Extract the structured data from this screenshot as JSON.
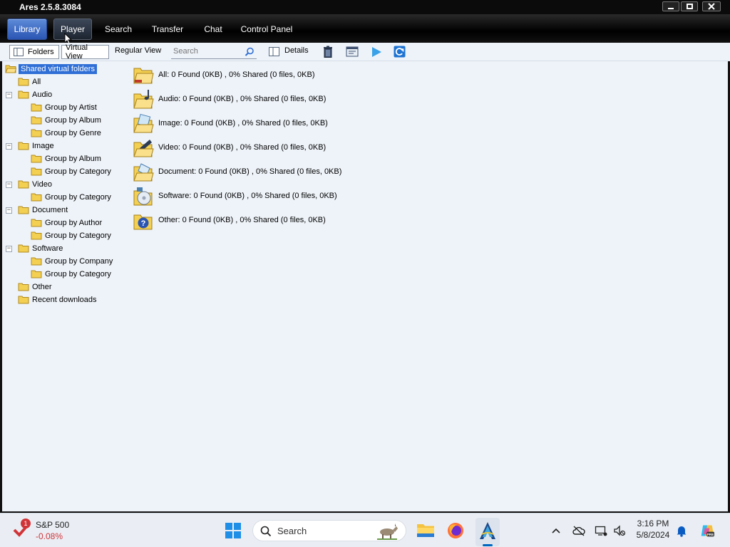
{
  "window": {
    "title": "Ares 2.5.8.3084"
  },
  "tabs": [
    {
      "label": "Library"
    },
    {
      "label": "Player"
    },
    {
      "label": "Search"
    },
    {
      "label": "Transfer"
    },
    {
      "label": "Chat"
    },
    {
      "label": "Control Panel"
    }
  ],
  "toolbar": {
    "folders_label": "Folders",
    "virtual_view_label": "Virtual View",
    "regular_view_label": "Regular View",
    "search_placeholder": "Search",
    "details_label": "Details"
  },
  "tree": {
    "root": "Shared virtual folders",
    "items": [
      {
        "label": "All"
      },
      {
        "label": "Audio"
      },
      {
        "label": "Group by Artist"
      },
      {
        "label": "Group by Album"
      },
      {
        "label": "Group by Genre"
      },
      {
        "label": "Image"
      },
      {
        "label": "Group by Album"
      },
      {
        "label": "Group by Category"
      },
      {
        "label": "Video"
      },
      {
        "label": "Group by Category"
      },
      {
        "label": "Document"
      },
      {
        "label": "Group by Author"
      },
      {
        "label": "Group by Category"
      },
      {
        "label": "Software"
      },
      {
        "label": "Group by Company"
      },
      {
        "label": "Group by Category"
      },
      {
        "label": "Other"
      },
      {
        "label": "Recent downloads"
      }
    ]
  },
  "list": [
    {
      "text": "All: 0 Found (0KB) , 0% Shared (0 files, 0KB)",
      "icon": "all-folder-icon"
    },
    {
      "text": "Audio: 0 Found (0KB) , 0% Shared (0 files, 0KB)",
      "icon": "audio-folder-icon"
    },
    {
      "text": "Image: 0 Found (0KB) , 0% Shared (0 files, 0KB)",
      "icon": "image-folder-icon"
    },
    {
      "text": "Video: 0 Found (0KB) , 0% Shared (0 files, 0KB)",
      "icon": "video-folder-icon"
    },
    {
      "text": "Document: 0 Found (0KB) , 0% Shared (0 files, 0KB)",
      "icon": "document-folder-icon"
    },
    {
      "text": "Software: 0 Found (0KB) , 0% Shared (0 files, 0KB)",
      "icon": "software-folder-icon"
    },
    {
      "text": "Other: 0 Found (0KB) , 0% Shared (0 files, 0KB)",
      "icon": "other-folder-icon"
    }
  ],
  "taskbar": {
    "stock_name": "S&P 500",
    "stock_change": "-0.08%",
    "stock_badge": "1",
    "search_placeholder": "Search",
    "time": "3:16 PM",
    "date": "5/8/2024"
  },
  "colors": {
    "accent": "#2f6fd6",
    "stock_negative": "#d13438",
    "folder": "#f3cf52"
  }
}
